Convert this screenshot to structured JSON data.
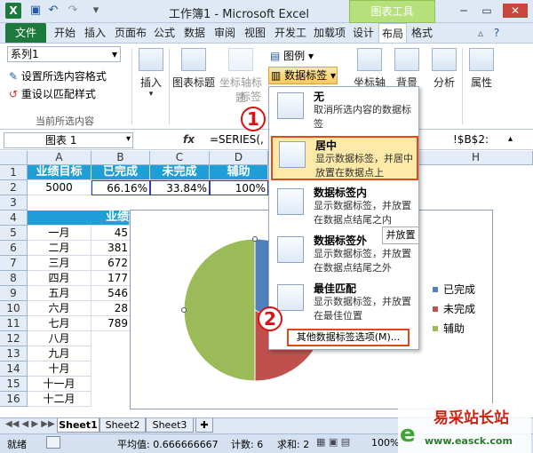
{
  "window": {
    "title": "工作簿1 - Microsoft Excel",
    "context_tool": "图表工具",
    "quick_access": [
      "save-icon",
      "undo-icon",
      "redo-icon"
    ]
  },
  "tabs": [
    "文件",
    "开始",
    "插入",
    "页面布",
    "公式",
    "数据",
    "审阅",
    "视图",
    "开发工",
    "加载项",
    "设计",
    "布局",
    "格式"
  ],
  "selected_tab": "布局",
  "ribbon": {
    "selection_box": "系列1",
    "format_selection": "设置所选内容格式",
    "reset_style": "重设以匹配样式",
    "group_current": "当前所选内容",
    "insert": "插入",
    "chart_title": "图表标题",
    "axis_title": "坐标轴标题",
    "legend": "图例",
    "data_labels": "数据标签",
    "axes": "坐标轴",
    "background": "背景",
    "analysis": "分析",
    "properties": "属性",
    "partial_label": "标签"
  },
  "formula_bar": {
    "name_box": "图表 1",
    "fx": "fx",
    "formula": "=SERIES(,",
    "formula_tail": "!$B$2:"
  },
  "grid": {
    "columns": [
      "A",
      "B",
      "C",
      "D",
      "H"
    ],
    "rows": [
      "1",
      "2",
      "3",
      "4",
      "5",
      "6",
      "7",
      "8",
      "9",
      "10",
      "11",
      "12",
      "13",
      "14",
      "15",
      "16"
    ],
    "header_row": [
      "业绩目标",
      "已完成",
      "未完成",
      "辅助"
    ],
    "value_row": [
      "5000",
      "66.16%",
      "33.84%",
      "100%"
    ],
    "a4_partial": "业绩",
    "months": [
      "一月",
      "二月",
      "三月",
      "四月",
      "五月",
      "六月",
      "七月",
      "八月",
      "九月",
      "十月",
      "十一月",
      "十二月"
    ],
    "month_values": [
      "45",
      "381",
      "672",
      "177",
      "546",
      "28",
      "789"
    ]
  },
  "chart_data": {
    "type": "pie",
    "series": [
      {
        "name": "系列1",
        "values": [
          66.16,
          33.84,
          100
        ]
      }
    ],
    "categories": [
      "已完成",
      "未完成",
      "辅助"
    ],
    "colors": [
      "#4f81bd",
      "#c0504d",
      "#9bbb59"
    ],
    "legend_position": "right"
  },
  "menu": {
    "items": [
      {
        "title": "无",
        "desc": "取消所选内容的数据标签"
      },
      {
        "title": "居中",
        "desc": "显示数据标签，并居中放置在数据点上"
      },
      {
        "title": "数据标签内",
        "desc": "显示数据标签，并放置在数据点结尾之内"
      },
      {
        "title": "数据标签外",
        "desc": "显示数据标签，并放置在数据点结尾之外"
      },
      {
        "title": "最佳匹配",
        "desc": "显示数据标签，并放置在最佳位置"
      }
    ],
    "more": "其他数据标签选项(M)...",
    "tooltip_partial": "并放置"
  },
  "callouts": [
    "1",
    "2"
  ],
  "sheets": [
    "Sheet1",
    "Sheet2",
    "Sheet3"
  ],
  "status": {
    "ready": "就绪",
    "average": "平均值: 0.666666667",
    "count": "计数: 6",
    "sum": "求和: 2",
    "zoom": "100%"
  },
  "watermark": {
    "name": "易采站长站",
    "url": "www.easck.com"
  }
}
